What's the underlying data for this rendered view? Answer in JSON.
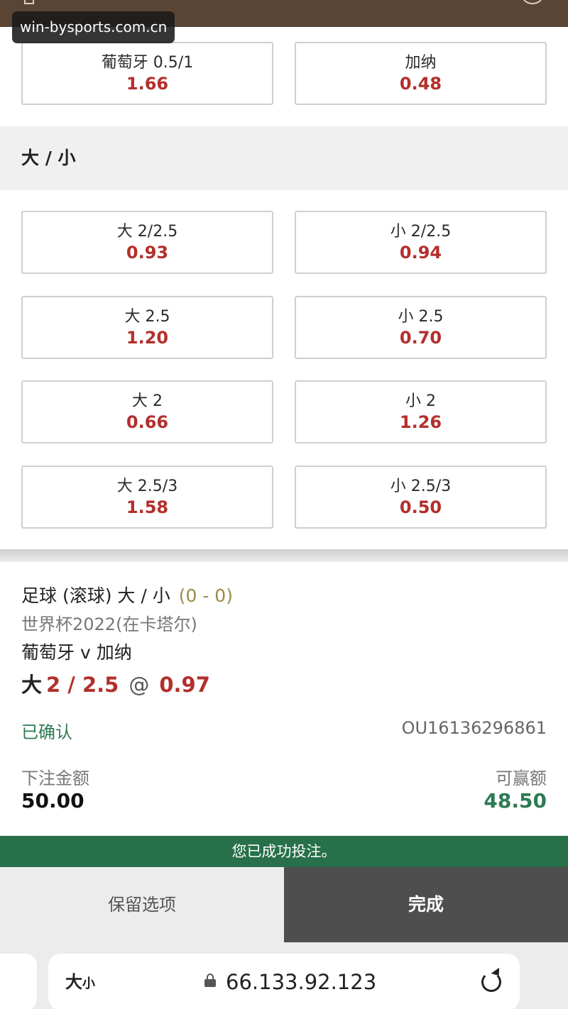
{
  "watermark": "win-bysports.com.cn",
  "handicap": {
    "home": {
      "label": "葡萄牙 0.5/1",
      "odds": "1.66"
    },
    "away": {
      "label": "加纳",
      "odds": "0.48"
    }
  },
  "over_under": {
    "title": "大 / 小",
    "rows": [
      {
        "over": {
          "label": "大 2/2.5",
          "odds": "0.93"
        },
        "under": {
          "label": "小 2/2.5",
          "odds": "0.94"
        }
      },
      {
        "over": {
          "label": "大 2.5",
          "odds": "1.20"
        },
        "under": {
          "label": "小 2.5",
          "odds": "0.70"
        }
      },
      {
        "over": {
          "label": "大 2",
          "odds": "0.66"
        },
        "under": {
          "label": "小 2",
          "odds": "1.26"
        }
      },
      {
        "over": {
          "label": "大 2.5/3",
          "odds": "1.58"
        },
        "under": {
          "label": "小 2.5/3",
          "odds": "0.50"
        }
      }
    ]
  },
  "bet_slip": {
    "market": "足球 (滚球) 大 / 小",
    "score": "(0 - 0)",
    "competition": "世界杯2022(在卡塔尔)",
    "match": "葡萄牙 v 加纳",
    "selection_prefix": "大",
    "selection_line": "2 / 2.5",
    "at_symbol": "@",
    "selection_odds": "0.97",
    "status": "已确认",
    "reference": "OU16136296861",
    "stake_label": "下注金额",
    "stake_value": "50.00",
    "win_label": "可赢额",
    "win_value": "48.50"
  },
  "success_message": "您已成功投注。",
  "buttons": {
    "keep": "保留选项",
    "done": "完成"
  },
  "browser": {
    "aa_large": "大",
    "aa_small": "小",
    "url": "66.133.92.123"
  }
}
